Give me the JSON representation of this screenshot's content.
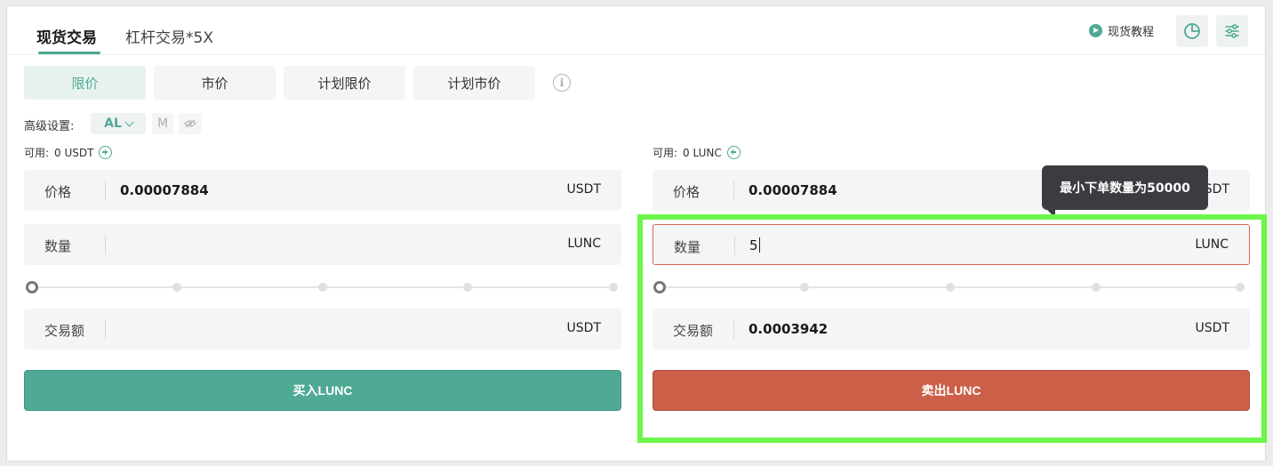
{
  "tabs": [
    {
      "label": "现货交易",
      "active": true
    },
    {
      "label": "杠杆交易*5X",
      "active": false
    }
  ],
  "header": {
    "tutorial_label": "现货教程"
  },
  "order_types": [
    {
      "label": "限价",
      "active": true
    },
    {
      "label": "市价",
      "active": false
    },
    {
      "label": "计划限价",
      "active": false
    },
    {
      "label": "计划市价",
      "active": false
    }
  ],
  "info_symbol": "i",
  "advanced": {
    "label": "高级设置:",
    "selected": "AL",
    "option_m": "M"
  },
  "buy": {
    "available_label": "可用:",
    "available_value": "0 USDT",
    "price_label": "价格",
    "price_value": "0.00007884",
    "price_unit": "USDT",
    "qty_label": "数量",
    "qty_value": "",
    "qty_unit": "LUNC",
    "amount_label": "交易额",
    "amount_value": "",
    "amount_unit": "USDT",
    "button_label": "买入LUNC"
  },
  "sell": {
    "available_label": "可用:",
    "available_value": "0 LUNC",
    "price_label": "价格",
    "price_value": "0.00007884",
    "price_unit": "USDT",
    "qty_label": "数量",
    "qty_value": "5",
    "qty_unit": "LUNC",
    "amount_label": "交易额",
    "amount_value": "0.0003942",
    "amount_unit": "USDT",
    "button_label": "卖出LUNC"
  },
  "tooltip": {
    "text": "最小下单数量为50000"
  },
  "colors": {
    "accent": "#4fa995",
    "sell": "#cb5f48",
    "highlight": "#6ef54a"
  }
}
